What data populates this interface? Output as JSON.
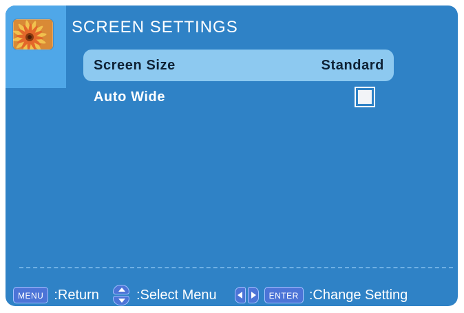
{
  "menu": {
    "title": "SCREEN SETTINGS",
    "icon": "flower-settings-icon",
    "items": [
      {
        "label": "Screen Size",
        "value": "Standard",
        "selected": true
      },
      {
        "label": "Auto Wide",
        "value_type": "checkbox",
        "checked": false
      }
    ]
  },
  "footer": {
    "menu_key": "MENU",
    "return_label": ":Return",
    "select_label": ":Select Menu",
    "enter_key": "ENTER",
    "change_label": ":Change Setting",
    "updown_icon": "up-down-arrows-icon",
    "leftright_icon": "left-right-arrows-icon"
  },
  "colors": {
    "background": "#2f82c6",
    "icon_tile": "#4fa7e8",
    "selected_row": "#8dc9f0",
    "key_button": "#4c74d7"
  }
}
